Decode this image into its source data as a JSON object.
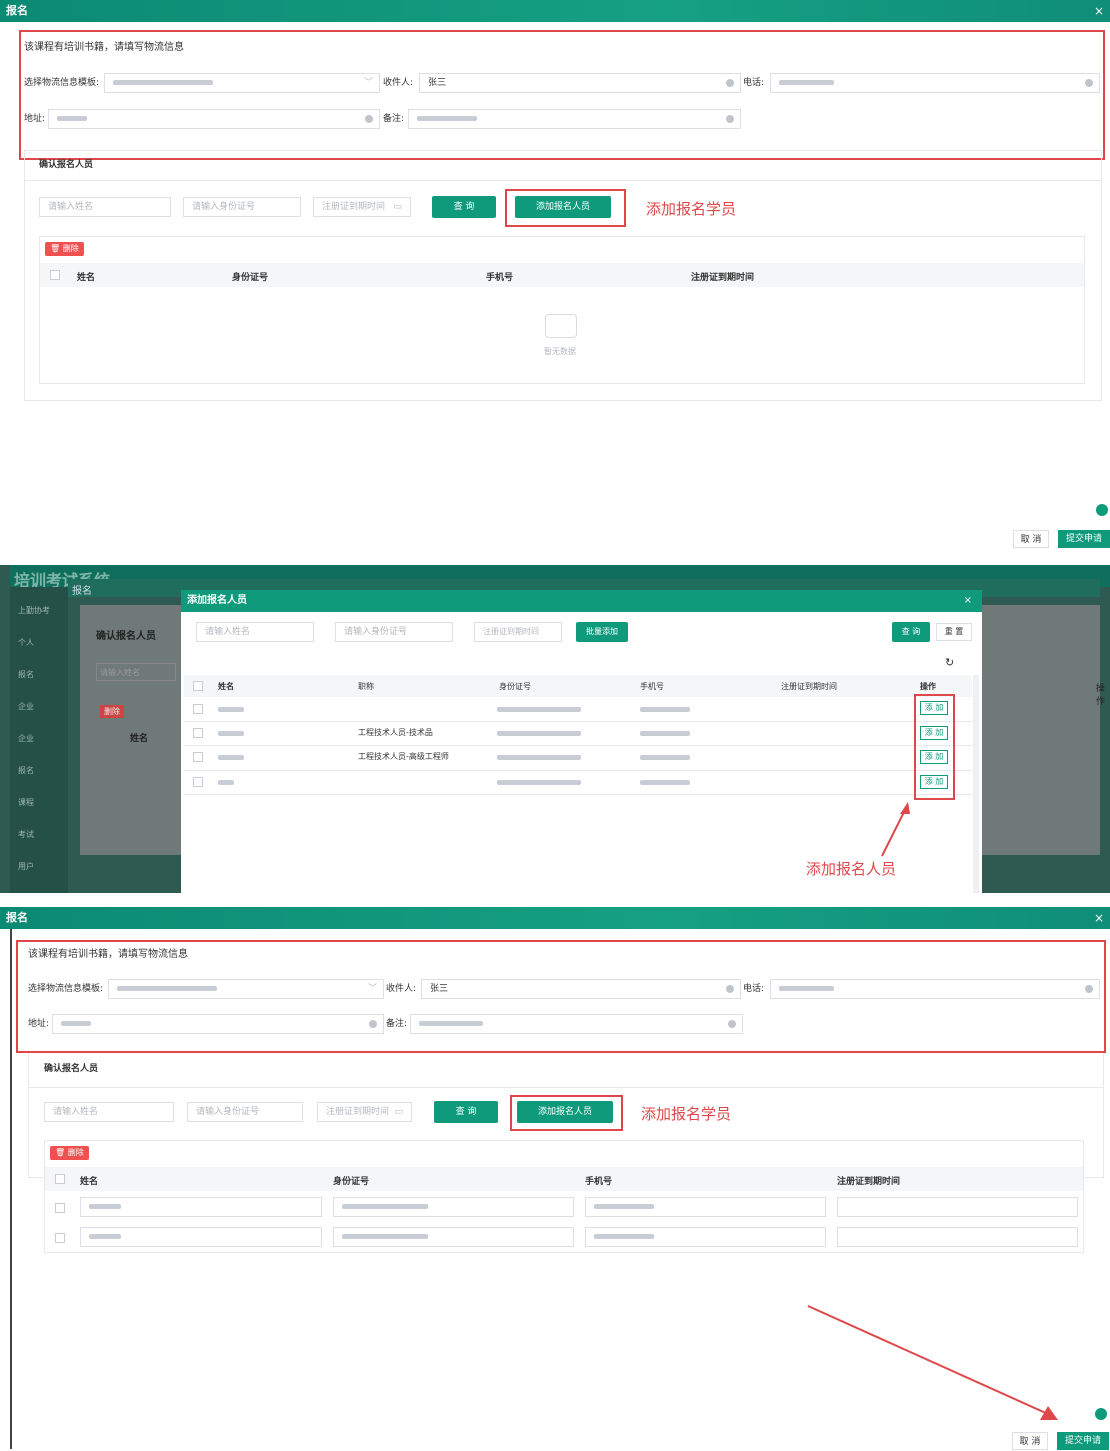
{
  "colors": {
    "primary": "#0f9a7c",
    "danger": "#f05050",
    "annotation": "#e0474a"
  },
  "dialog": {
    "title": "报名",
    "close": "×"
  },
  "logistics": {
    "notice": "该课程有培训书籍，请填写物流信息",
    "template_label": "选择物流信息模板:",
    "receiver_label": "收件人:",
    "receiver_value": "张三",
    "phone_label": "电话:",
    "address_label": "地址:",
    "remark_label": "备注:"
  },
  "confirm": {
    "title": "确认报名人员",
    "name_placeholder": "请输入姓名",
    "id_placeholder": "请输入身份证号",
    "date_placeholder": "注册证到期时间",
    "query_button": "查 询",
    "add_button": "添加报名人员",
    "delete_button": "删除",
    "columns": [
      "姓名",
      "身份证号",
      "手机号",
      "注册证到期时间"
    ],
    "empty_text": "暂无数据"
  },
  "annotations": {
    "add_student": "添加报名学员",
    "add_person": "添加报名人员"
  },
  "footer": {
    "cancel": "取 消",
    "submit": "提交申请"
  },
  "system": {
    "title": "培训考试系统"
  },
  "sidebar": {
    "items": [
      "上勤协考",
      "个人",
      "报名",
      "企业",
      "企业",
      "报名",
      "课程",
      "考试",
      "用户"
    ]
  },
  "add_dialog": {
    "title": "添加报名人员",
    "name_placeholder": "请输入姓名",
    "id_placeholder": "请输入身份证号",
    "date_placeholder": "注册证到期时间",
    "batch_button": "批量添加",
    "query_button": "查 询",
    "reset_button": "重 置",
    "columns": [
      "姓名",
      "职称",
      "身份证号",
      "手机号",
      "注册证到期时间",
      "操作"
    ],
    "rows": [
      {
        "title": ""
      },
      {
        "title": "工程技术人员-技术品"
      },
      {
        "title": "工程技术人员-高级工程师"
      },
      {
        "title": ""
      }
    ],
    "add_label": "添 加"
  },
  "bg_labels": {
    "confirm": "确认报名人员",
    "name_placeholder": "请输入姓名",
    "delete": "删除",
    "name": "姓名",
    "action": "操作"
  }
}
